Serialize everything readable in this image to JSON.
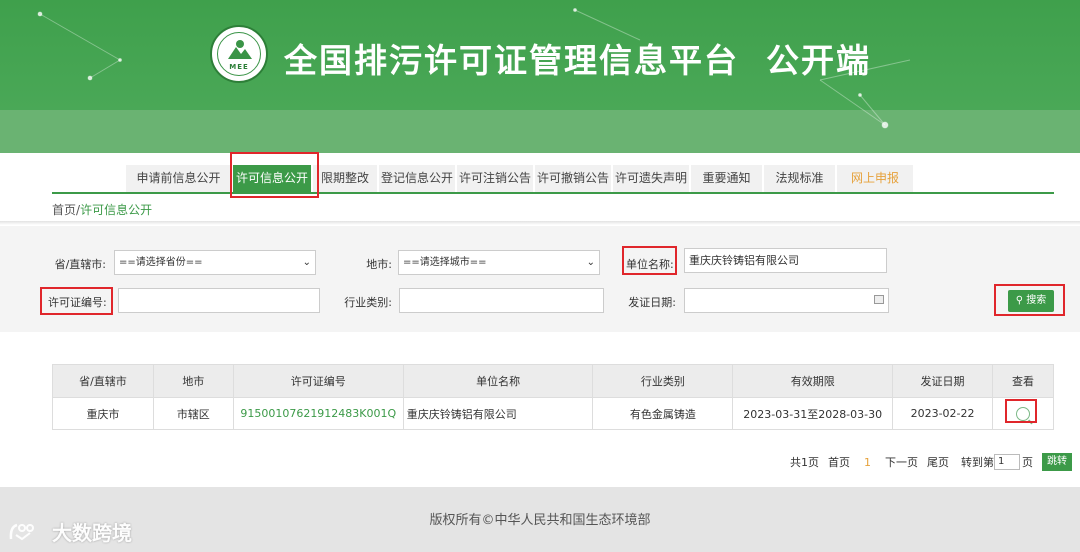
{
  "header": {
    "title": "全国排污许可证管理信息平台  公开端",
    "logo_text": "MEE"
  },
  "nav": {
    "tabs": [
      {
        "label": "申请前信息公开",
        "active": false
      },
      {
        "label": "许可信息公开",
        "active": true
      },
      {
        "label": "限期整改",
        "active": false
      },
      {
        "label": "登记信息公开",
        "active": false
      },
      {
        "label": "许可注销公告",
        "active": false
      },
      {
        "label": "许可撤销公告",
        "active": false
      },
      {
        "label": "许可遗失声明",
        "active": false
      },
      {
        "label": "重要通知",
        "active": false
      },
      {
        "label": "法规标准",
        "active": false
      },
      {
        "label": "网上申报",
        "active": false
      }
    ]
  },
  "breadcrumb": {
    "home": "首页",
    "sep": "/",
    "current": "许可信息公开"
  },
  "filter": {
    "province_label": "省/直辖市:",
    "province_value": "==请选择省份==",
    "city_label": "地市:",
    "city_value": "==请选择城市==",
    "unit_label": "单位名称:",
    "unit_value": "重庆庆铃铸铝有限公司",
    "license_label": "许可证编号:",
    "license_value": "",
    "industry_label": "行业类别:",
    "industry_value": "",
    "date_label": "发证日期:",
    "date_value": "",
    "search_label": "搜索"
  },
  "table": {
    "headers": [
      "省/直辖市",
      "地市",
      "许可证编号",
      "单位名称",
      "行业类别",
      "有效期限",
      "发证日期",
      "查看"
    ],
    "rows": [
      [
        "重庆市",
        "市辖区",
        "91500107621912483K001Q",
        "重庆庆铃铸铝有限公司",
        "有色金属铸造",
        "2023-03-31至2028-03-30",
        "2023-02-22"
      ]
    ]
  },
  "pager": {
    "total": "共1页",
    "first": "首页",
    "current": "1",
    "next": "下一页",
    "last": "尾页",
    "goto_prefix": "转到第",
    "goto_value": "1",
    "goto_suffix": "页",
    "jump": "跳转"
  },
  "footer": {
    "copyright": "版权所有©中华人民共和国生态环境部"
  },
  "watermark": {
    "text": "大数跨境"
  },
  "colors": {
    "brand_green": "#3c9a48",
    "highlight_red": "#e0262b",
    "report_orange": "#e6a23c"
  }
}
